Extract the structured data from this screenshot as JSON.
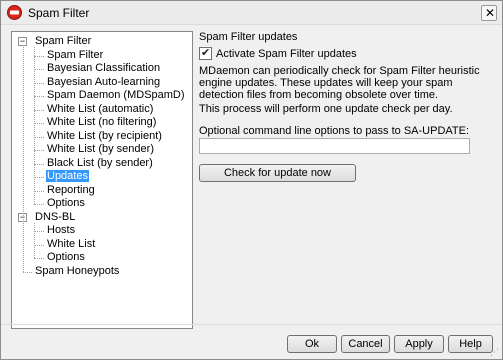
{
  "window": {
    "title": "Spam Filter",
    "app_icon": "spam-filter-icon"
  },
  "tree": {
    "items": [
      {
        "label": "Spam Filter",
        "level": 0,
        "expanded": true,
        "selected": false
      },
      {
        "label": "Spam Filter",
        "level": 1,
        "selected": false
      },
      {
        "label": "Bayesian Classification",
        "level": 1,
        "selected": false
      },
      {
        "label": "Bayesian Auto-learning",
        "level": 1,
        "selected": false
      },
      {
        "label": "Spam Daemon (MDSpamD)",
        "level": 1,
        "selected": false
      },
      {
        "label": "White List (automatic)",
        "level": 1,
        "selected": false
      },
      {
        "label": "White List (no filtering)",
        "level": 1,
        "selected": false
      },
      {
        "label": "White List (by recipient)",
        "level": 1,
        "selected": false
      },
      {
        "label": "White List (by sender)",
        "level": 1,
        "selected": false
      },
      {
        "label": "Black List (by sender)",
        "level": 1,
        "selected": false
      },
      {
        "label": "Updates",
        "level": 1,
        "selected": true
      },
      {
        "label": "Reporting",
        "level": 1,
        "selected": false
      },
      {
        "label": "Options",
        "level": 1,
        "selected": false
      },
      {
        "label": "DNS-BL",
        "level": 0,
        "expanded": true,
        "selected": false
      },
      {
        "label": "Hosts",
        "level": 1,
        "selected": false
      },
      {
        "label": "White List",
        "level": 1,
        "selected": false
      },
      {
        "label": "Options",
        "level": 1,
        "selected": false
      },
      {
        "label": "Spam Honeypots",
        "level": 0,
        "selected": false
      }
    ]
  },
  "panel": {
    "group_title": "Spam Filter updates",
    "activate_checkbox": {
      "label": "Activate Spam Filter updates",
      "checked": true
    },
    "description": "MDaemon can periodically check for Spam Filter heuristic engine updates. These updates will keep your spam detection files from becoming obsolete over time.",
    "frequency_note": "This process will perform one update check per day.",
    "options_label": "Optional command line options to pass to SA-UPDATE:",
    "options_value": "",
    "check_button": "Check for update now"
  },
  "footer": {
    "ok": "Ok",
    "cancel": "Cancel",
    "apply": "Apply",
    "help": "Help"
  },
  "colors": {
    "selection": "#3399ff",
    "window_bg": "#f0f0f0",
    "icon_red": "#d9261c"
  }
}
